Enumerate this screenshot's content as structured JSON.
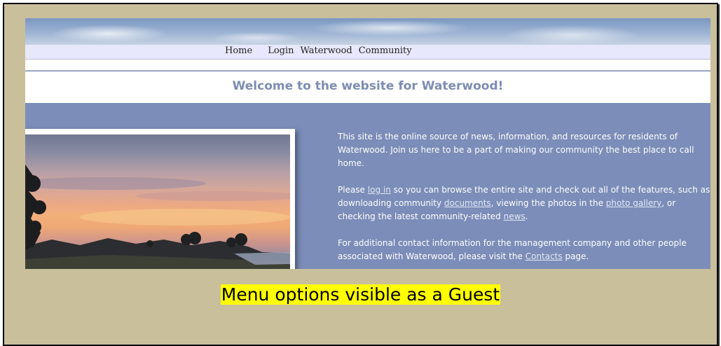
{
  "nav": {
    "home": "Home",
    "login": "Login",
    "waterwood": "Waterwood",
    "community": "Community"
  },
  "welcome": {
    "title": "Welcome to the website for Waterwood!"
  },
  "intro": {
    "p1": "This site is the online source of news, information, and resources for residents of Waterwood.  Join us here to be a part of making our community the best place to call home.",
    "p2_a": "Please ",
    "p2_link_login": "log in",
    "p2_b": " so you can browse the entire site and check out all of the features, such as downloading community ",
    "p2_link_documents": "documents",
    "p2_c": ", viewing the photos in the ",
    "p2_link_photo_gallery": "photo gallery",
    "p2_d": ", or checking the latest community-related ",
    "p2_link_news": "news",
    "p2_e": ".",
    "p3_a": "For additional contact information for the management company and other people associated with Waterwood, please visit the ",
    "p3_link_contacts": "Contacts",
    "p3_b": " page."
  },
  "caption": "Menu options visible as a Guest",
  "colors": {
    "frame_bg": "#c9bf9b",
    "site_bg": "#7b8db8",
    "menu_bg": "#e7e8fb",
    "welcome_text": "#7d8db1",
    "caption_highlight": "#ffff00"
  }
}
